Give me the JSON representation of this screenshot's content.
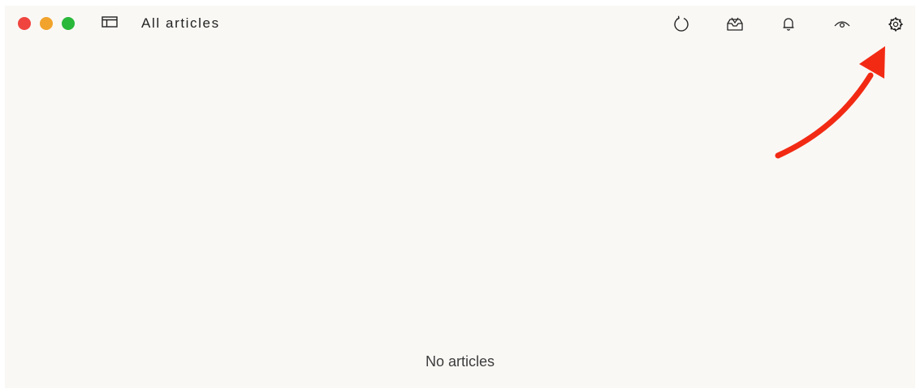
{
  "window": {
    "title": "All articles",
    "background": "#faf8f5",
    "traffic_lights": {
      "close": "#f0453f",
      "minimize": "#f2a32b",
      "maximize": "#29b83a"
    }
  },
  "toolbar": {
    "icons": [
      "sidebar-icon",
      "refresh-icon",
      "inbox-icon",
      "bell-icon",
      "eye-icon",
      "gear-icon"
    ]
  },
  "main": {
    "empty_text": "No articles"
  },
  "annotation": {
    "arrow_color": "#f22a14",
    "points_to": "gear-icon"
  }
}
